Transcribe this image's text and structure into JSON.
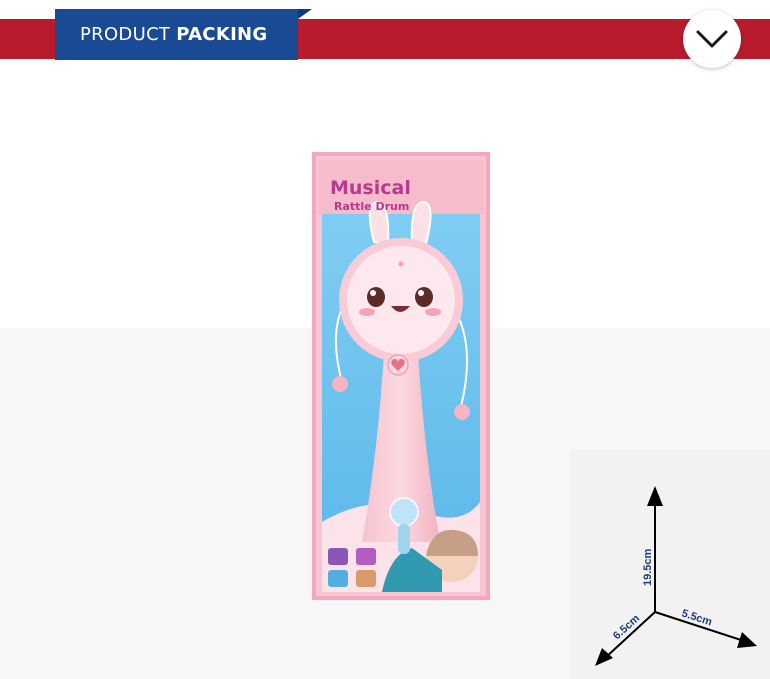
{
  "header": {
    "title_light": "PRODUCT",
    "title_bold": "PACKING",
    "toggle_icon": "chevron-down-icon"
  },
  "colors": {
    "bar": "#b81c2c",
    "tab": "#1a4a93",
    "box_pink": "#f4b8c6",
    "box_blue": "#6ec3ee"
  },
  "product": {
    "title_line1": "Musical",
    "title_line2": "Rattle Drum"
  },
  "dimensions": {
    "height": "19.5cm",
    "width": "5.5cm",
    "depth": "6.5cm"
  }
}
